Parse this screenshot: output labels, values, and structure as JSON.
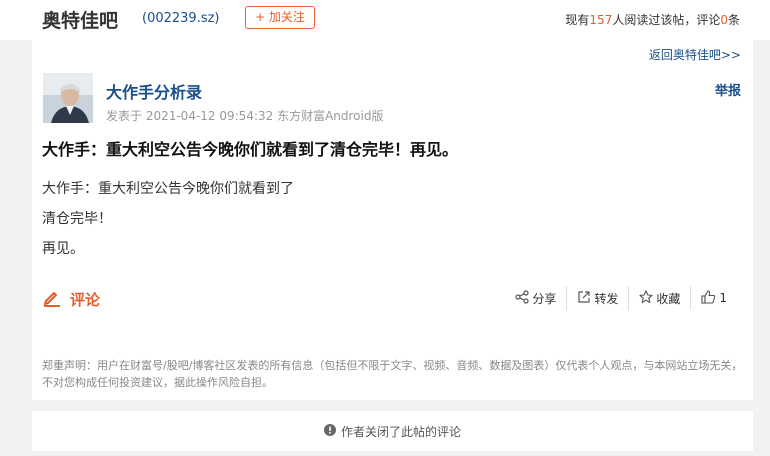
{
  "bar": {
    "name": "奥特佳吧",
    "code": "(002239.sz)",
    "follow_label": "+ 加关注",
    "stats_prefix": "现有",
    "readers": "157",
    "stats_middle": "人阅读过该帖，评论",
    "comments": "0",
    "stats_suffix": "条"
  },
  "nav": {
    "back_label": "返回奥特佳吧>>"
  },
  "post": {
    "author": "大作手分析录",
    "meta": "发表于 2021-04-12 09:54:32 东方财富Android版",
    "report_label": "举报",
    "title": "大作手：重大利空公告今晚你们就看到了清仓完毕！再见。",
    "body_lines": [
      "大作手：重大利空公告今晚你们就看到了",
      "清仓完毕！",
      "再见。"
    ]
  },
  "actions": {
    "comment_label": "评论",
    "share_label": "分享",
    "repost_label": "转发",
    "favorite_label": "收藏",
    "like_count": "1"
  },
  "disclaimer": "郑重声明：用户在财富号/股吧/博客社区发表的所有信息（包括但不限于文字、视频、音频、数据及图表）仅代表个人观点，与本网站立场无关，不对您构成任何投资建议，据此操作风险自担。",
  "comments_closed": "作者关闭了此帖的评论",
  "colors": {
    "accent": "#e35f2d",
    "link": "#1a4f8b"
  }
}
